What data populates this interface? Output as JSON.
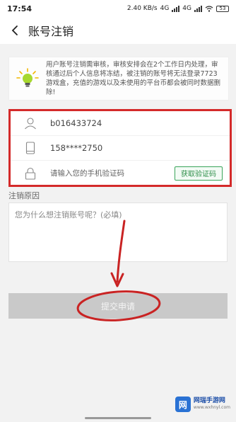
{
  "status_bar": {
    "time": "17:54",
    "net_speed": "2.40 KB/s",
    "network_left": "4G",
    "network_right": "4G",
    "battery": "53"
  },
  "header": {
    "back_icon": "chevron-left-icon",
    "title": "账号注销"
  },
  "notice": {
    "icon": "lightbulb-icon",
    "text": "用户账号注销需审核，审核安排会在2个工作日内处理，审核通过后个人信息将冻结，被注销的账号将无法登录7723游戏盒，充值的游戏以及未使用的平台币都会被同时数据删除!"
  },
  "form": {
    "username": "b016433724",
    "phone": "158****2750",
    "code_placeholder": "请输入您的手机验证码",
    "get_code_label": "获取验证码"
  },
  "reason": {
    "label": "注销原因",
    "placeholder": "您为什么想注销账号呢？(必填)"
  },
  "submit": {
    "label": "提交申请"
  },
  "watermark": {
    "logo_char": "网",
    "name": "网瑞手游网",
    "url": "www.wxhnyl.com"
  },
  "colors": {
    "annotation_red": "#d42a2a",
    "accent_green": "#3aa55a",
    "submit_disabled": "#c9c9c9"
  }
}
